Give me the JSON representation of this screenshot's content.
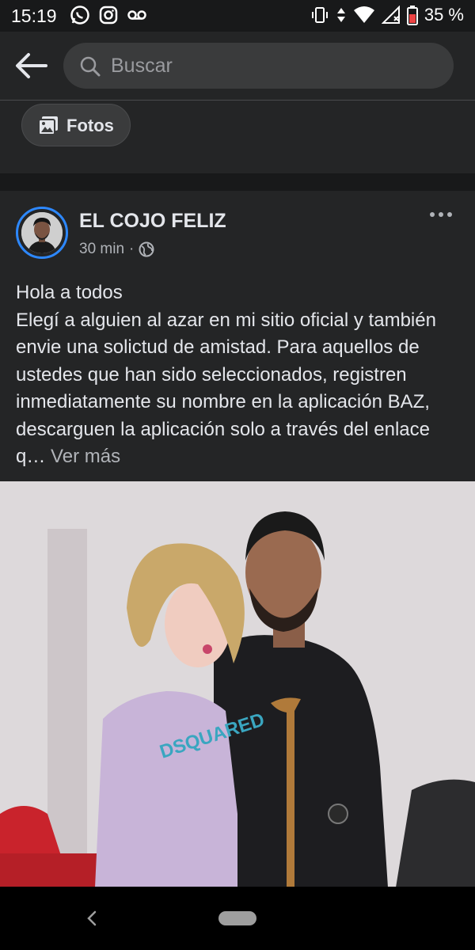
{
  "status_bar": {
    "time": "15:19",
    "battery": "35 %",
    "icons_left": [
      "whatsapp-icon",
      "instagram-icon",
      "voicemail-icon"
    ],
    "icons_right": [
      "vibrate-icon",
      "data-icon",
      "wifi-icon",
      "signal-icon",
      "battery-icon"
    ]
  },
  "search": {
    "placeholder": "Buscar"
  },
  "filters": {
    "photos_label": "Fotos"
  },
  "post": {
    "author": "EL COJO FELIZ",
    "time": "30 min",
    "separator": "·",
    "visibility_icon": "globe-icon",
    "text_line1": "Hola a todos",
    "text_body": "Elegí a alguien al azar en mi sitio oficial y también envie una solictud de amistad. Para aquellos de ustedes que han sido seleccionados, registren inmediatamente su nombre en la aplicación BAZ, descarguen la aplicación solo a través del enlace q…",
    "see_more": "Ver más",
    "photo_text": "DSQUARED"
  },
  "colors": {
    "background": "#18191a",
    "surface": "#242526",
    "input": "#3a3b3c",
    "accent_ring": "#2d88ff",
    "text_primary": "#e4e6eb",
    "text_secondary": "#b0b3b8"
  }
}
